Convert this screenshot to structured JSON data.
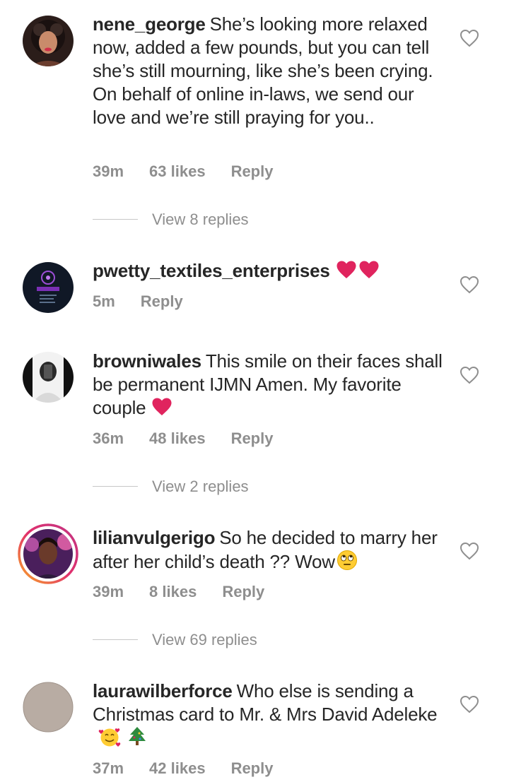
{
  "comments": [
    {
      "username": "nene_george",
      "text": "She’s looking more relaxed now, added a few pounds, but you can tell she’s still mourning, like she’s been crying. On behalf of online in-laws, we send our love and we’re still praying for you..",
      "time": "39m",
      "likes": "63 likes",
      "reply": "Reply",
      "view_replies": "View 8 replies",
      "like_icon": "heart-outline-icon"
    },
    {
      "username": "pwetty_textiles_enterprises",
      "text": "",
      "emojis": [
        "red-heart-emoji",
        "red-heart-emoji"
      ],
      "time": "5m",
      "reply": "Reply",
      "like_icon": "heart-outline-icon"
    },
    {
      "username": "browniwales",
      "text": "This smile on their faces shall be permanent IJMN Amen. My favorite couple",
      "emojis": [
        "red-heart-emoji"
      ],
      "time": "36m",
      "likes": "48 likes",
      "reply": "Reply",
      "view_replies": "View 2 replies",
      "like_icon": "heart-outline-icon"
    },
    {
      "username": "lilianvulgerigo",
      "text": "So he decided to marry her after her child’s death ?? Wow",
      "emojis": [
        "eye-roll-emoji"
      ],
      "time": "39m",
      "likes": "8 likes",
      "reply": "Reply",
      "view_replies": "View 69 replies",
      "like_icon": "heart-outline-icon"
    },
    {
      "username": "laurawilberforce",
      "text": "Who else is sending a Christmas card to Mr. & Mrs David Adeleke",
      "emojis": [
        "smiling-face-with-hearts-emoji",
        "christmas-tree-emoji"
      ],
      "time": "37m",
      "likes": "42 likes",
      "reply": "Reply",
      "like_icon": "heart-outline-icon"
    }
  ],
  "colors": {
    "text": "#262626",
    "meta": "#8e8e8e",
    "divider": "#c7c7c7",
    "heart_emoji": "#e0245e",
    "story_ring_start": "#f9a825",
    "story_ring_end": "#c13584"
  }
}
